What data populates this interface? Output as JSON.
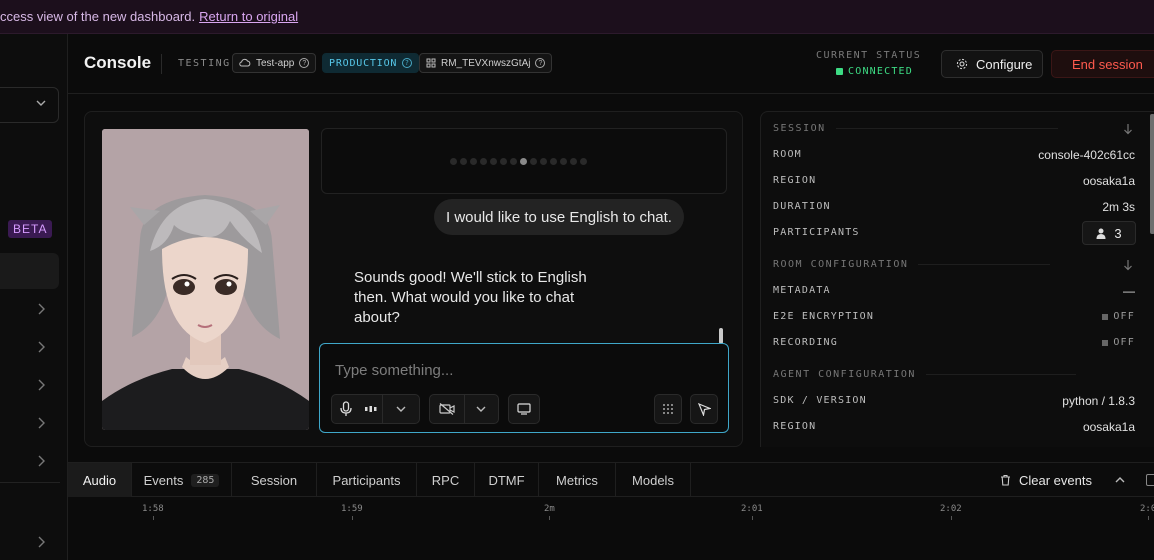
{
  "banner": {
    "text": "ccess view of the new dashboard.",
    "link": "Return to original"
  },
  "sidebar": {
    "beta_label": "BETA"
  },
  "header": {
    "title": "Console",
    "testing_label": "TESTING",
    "chips": [
      {
        "label": "Test-app",
        "icon": "cloud-icon"
      },
      {
        "label": "PRODUCTION"
      },
      {
        "label": "RM_TEVXnwszGtAj",
        "icon": "room-icon"
      }
    ],
    "status_label": "CURRENT STATUS",
    "status_value": "CONNECTED",
    "status_color": "#3ddc84",
    "configure_label": "Configure",
    "end_session_label": "End session",
    "end_color": "#ff5a4e"
  },
  "chat": {
    "user_message": "I would like to use English to chat.",
    "agent_message": "Sounds good! We'll stick to English then. What would you like to chat about?",
    "input_placeholder": "Type something..."
  },
  "session": {
    "section_label": "SESSION",
    "rows": [
      {
        "key": "ROOM",
        "value": "console-402c61cc"
      },
      {
        "key": "REGION",
        "value": "oosaka1a"
      },
      {
        "key": "DURATION",
        "value": "2m 3s"
      },
      {
        "key": "PARTICIPANTS",
        "value": "3"
      }
    ]
  },
  "room_config": {
    "section_label": "ROOM CONFIGURATION",
    "rows": [
      {
        "key": "METADATA",
        "value": "—"
      },
      {
        "key": "E2E ENCRYPTION",
        "value": "OFF"
      },
      {
        "key": "RECORDING",
        "value": "OFF"
      }
    ]
  },
  "agent_config": {
    "section_label": "AGENT CONFIGURATION",
    "rows": [
      {
        "key": "SDK / VERSION",
        "value": "python / 1.8.3"
      },
      {
        "key": "REGION",
        "value": "oosaka1a"
      }
    ]
  },
  "tabs": [
    {
      "label": "Audio"
    },
    {
      "label": "Events",
      "count": "285"
    },
    {
      "label": "Session"
    },
    {
      "label": "Participants"
    },
    {
      "label": "RPC"
    },
    {
      "label": "DTMF"
    },
    {
      "label": "Metrics"
    },
    {
      "label": "Models"
    }
  ],
  "clear_events_label": "Clear events",
  "timeline_ticks": [
    "1:58",
    "1:59",
    "2m",
    "2:01",
    "2:02",
    "2:0"
  ]
}
